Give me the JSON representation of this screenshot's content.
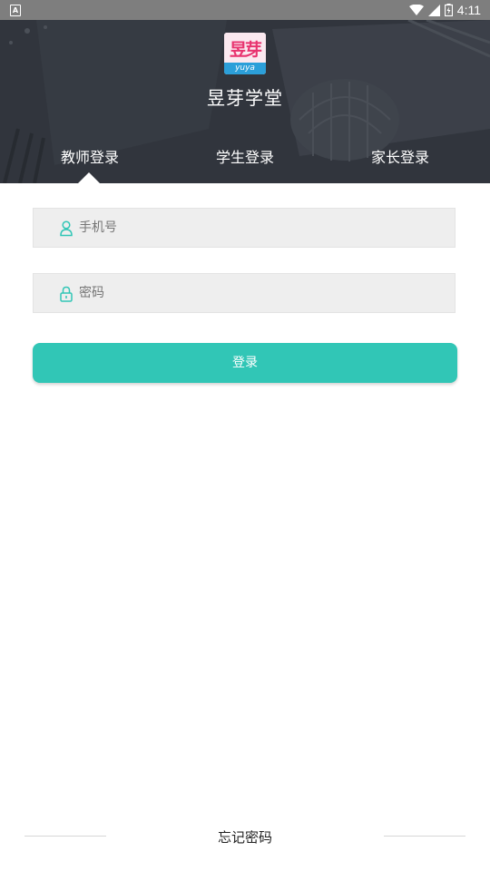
{
  "status_bar": {
    "notification_icon": "notification-a-icon",
    "wifi_icon": "wifi-icon",
    "signal_icon": "cell-signal-icon",
    "battery_icon": "battery-icon",
    "time": "4:11"
  },
  "header": {
    "logo": {
      "glyphs": "昱芽",
      "latin": "yuya"
    },
    "app_title": "昱芽学堂",
    "tabs": [
      {
        "label": "教师登录",
        "selected": true
      },
      {
        "label": "学生登录",
        "selected": false
      },
      {
        "label": "家长登录",
        "selected": false
      }
    ]
  },
  "form": {
    "phone": {
      "placeholder": "手机号",
      "value": ""
    },
    "password": {
      "placeholder": "密码",
      "value": ""
    },
    "submit_label": "登录"
  },
  "footer": {
    "forgot_password_label": "忘记密码"
  },
  "colors": {
    "accent": "#31c6b6",
    "header_bg": "#363b43",
    "field_bg": "#eeeeee"
  }
}
